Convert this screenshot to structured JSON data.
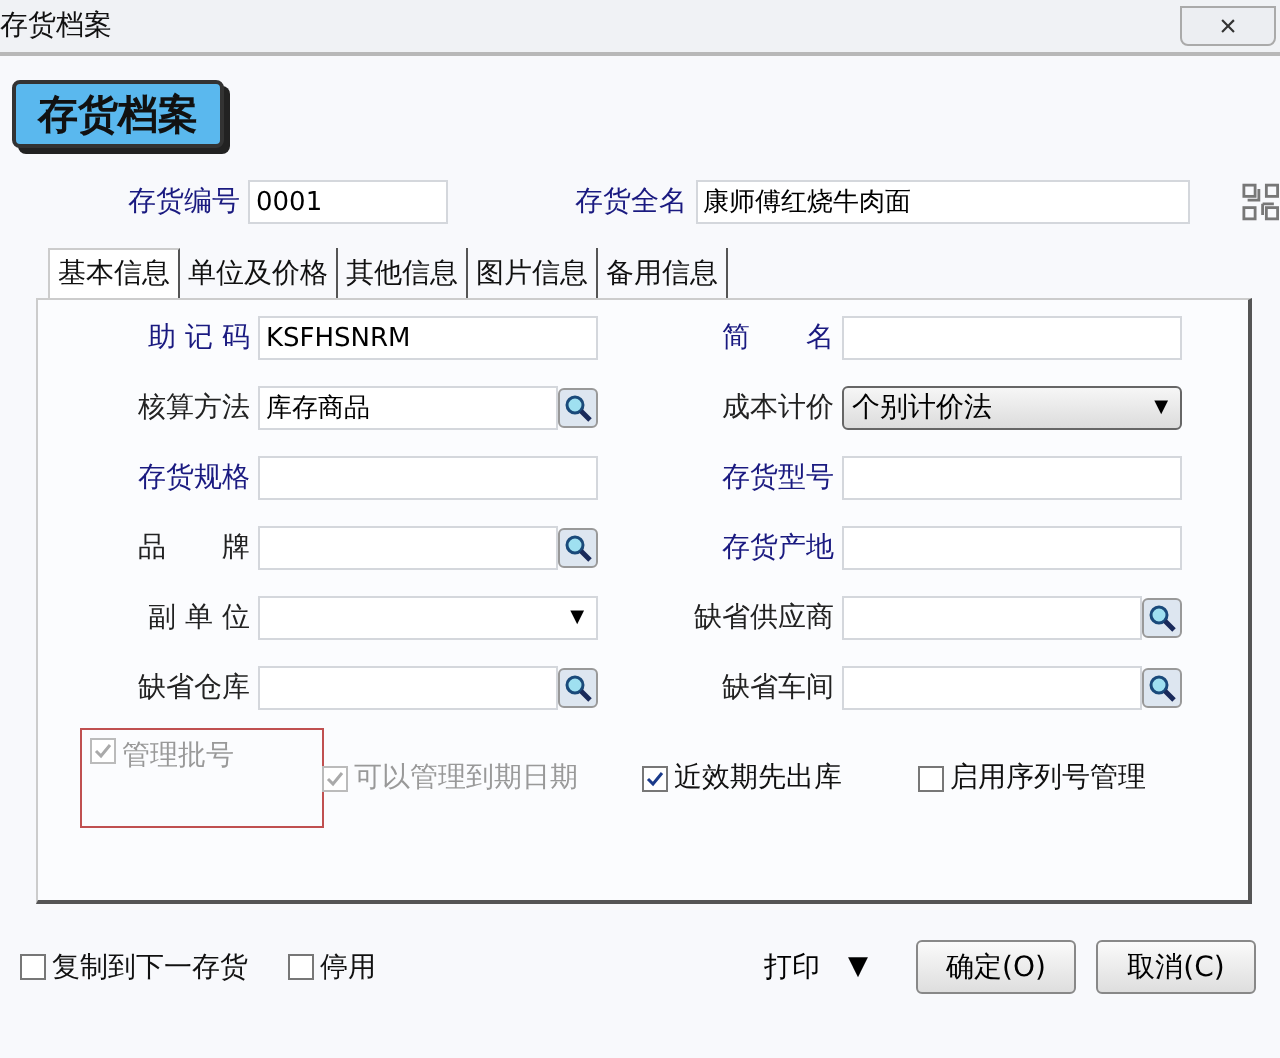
{
  "window": {
    "title": "存货档案",
    "close": "×"
  },
  "header": "存货档案",
  "top_fields": [
    {
      "label": "存货编号",
      "value": "0001",
      "color": "#1a1a80"
    },
    {
      "label": "存货全名",
      "value": "康师傅红烧牛肉面",
      "color": "#1a1a80"
    }
  ],
  "tabs": [
    {
      "label": "基本信息",
      "selected": true
    },
    {
      "label": "单位及价格",
      "selected": false
    },
    {
      "label": "其他信息",
      "selected": false
    },
    {
      "label": "图片信息",
      "selected": false
    },
    {
      "label": "备用信息",
      "selected": false
    }
  ],
  "left_fields": [
    {
      "label": "助 记 码",
      "value": "KSFHSNRM",
      "kind": "text",
      "color": "#1a1a80"
    },
    {
      "label": "核算方法",
      "value": "库存商品",
      "kind": "lookup",
      "color": "#222222"
    },
    {
      "label": "存货规格",
      "kind": "text",
      "color": "#1a1a80"
    },
    {
      "label": "品　　牌",
      "kind": "lookup",
      "color": "#222222"
    },
    {
      "label": "副 单 位",
      "kind": "dropdown",
      "color": "#222222"
    },
    {
      "label": "缺省仓库",
      "kind": "lookup",
      "color": "#222222"
    }
  ],
  "right_fields": [
    {
      "label": "简　　名",
      "kind": "text",
      "color": "#1a1a80"
    },
    {
      "label": "成本计价",
      "value": "个别计价法",
      "kind": "select",
      "color": "#222222"
    },
    {
      "label": "存货型号",
      "kind": "text",
      "color": "#1a1a80"
    },
    {
      "label": "存货产地",
      "kind": "text",
      "color": "#1a1a80"
    },
    {
      "label": "缺省供应商",
      "kind": "lookup",
      "color": "#222222"
    },
    {
      "label": "缺省车间",
      "kind": "lookup",
      "color": "#222222"
    }
  ],
  "options": [
    {
      "label": "管理批号",
      "checked": true,
      "disabled": true,
      "highlighted": true
    },
    {
      "label": "可以管理到期日期",
      "checked": true,
      "disabled": true,
      "highlighted": false
    },
    {
      "label": "近效期先出库",
      "checked": true,
      "disabled": false,
      "highlighted": false
    },
    {
      "label": "启用序列号管理",
      "checked": false,
      "disabled": false,
      "highlighted": false
    }
  ],
  "footer_options": [
    {
      "label": "复制到下一存货",
      "checked": false
    },
    {
      "label": "停用",
      "checked": false
    }
  ],
  "print": {
    "label": "打印",
    "arrow": "▼"
  },
  "buttons": [
    "确定(O)",
    "取消(C)"
  ]
}
